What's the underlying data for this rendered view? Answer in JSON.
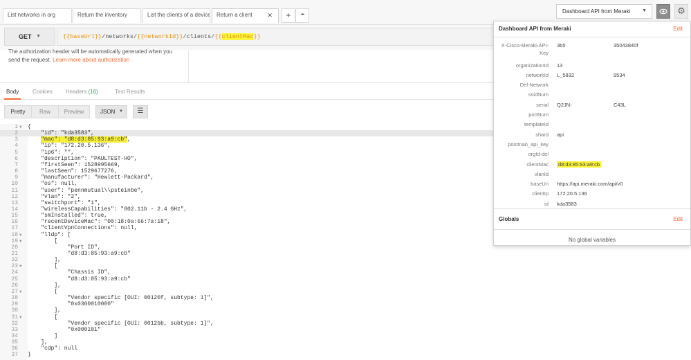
{
  "tabs": [
    {
      "label": "List networks in org"
    },
    {
      "label": "Return the inventory"
    },
    {
      "label": "List the clients of a device,"
    },
    {
      "label": "Return a client",
      "close": "✕"
    }
  ],
  "tab_actions": {
    "add": "+",
    "more": "•••"
  },
  "environment": {
    "selected": "Dashboard API from Meraki"
  },
  "request": {
    "method": "GET",
    "url_parts": [
      "{{baseUrl}}",
      "/networks/",
      "{{networkId}}",
      "/clients/",
      "{{",
      "clientMac",
      "}}"
    ]
  },
  "auth": {
    "text": "The authorization header will be automatically generated when you send the request.",
    "link": "Learn more about authorization"
  },
  "response_tabs": [
    {
      "label": "Body"
    },
    {
      "label": "Cookies"
    },
    {
      "label": "Headers",
      "count": "(16)"
    },
    {
      "label": "Test Results"
    }
  ],
  "toolbar": {
    "pretty": "Pretty",
    "raw": "Raw",
    "preview": "Preview",
    "format": "JSON"
  },
  "code_lines": [
    "{",
    "    \"id\": \"kda3583\",",
    "    \"mac\": \"d8:d3:85:93:a9:cb\",",
    "    \"ip\": \"172.20.5.136\",",
    "    \"ip6\": \"\",",
    "    \"description\": \"PAULTEST-HO\",",
    "    \"firstSeen\": 1528995669,",
    "    \"lastSeen\": 1529677276,",
    "    \"manufacturer\": \"Hewlett-Packard\",",
    "    \"os\": null,",
    "    \"user\": \"pennmutual\\\\psteinbe\",",
    "    \"vlan\": \"2\",",
    "    \"switchport\": \"1\",",
    "    \"wirelessCapabilities\": \"802.11b - 2.4 GHz\",",
    "    \"smInstalled\": true,",
    "    \"recentDeviceMac\": \"00:18:0a:66:7a:18\",",
    "    \"clientVpnConnections\": null,",
    "    \"lldp\": [",
    "        [",
    "            \"Port ID\",",
    "            \"d8:d3:85:93:a9:cb\"",
    "        ],",
    "        [",
    "            \"Chassis ID\",",
    "            \"d8:d3:85:93:a9:cb\"",
    "        ],",
    "        [",
    "            \"Vendor specific [OUI: 00120f, subtype: 1]\",",
    "            \"0x0300010000\"",
    "        ],",
    "        [",
    "            \"Vendor specific [OUI: 0012bb, subtype: 1]\",",
    "            \"0x000101\"",
    "        ]",
    "    ],",
    "    \"cdp\": null",
    "}"
  ],
  "env_popover": {
    "title": "Dashboard API from Meraki",
    "edit": "Edit",
    "variables": [
      {
        "key": "X-Cisco-Meraki-API-",
        "key2": "Key",
        "value": "3b5",
        "value2": "35043840f"
      },
      {
        "key": "organizationId",
        "value": "13"
      },
      {
        "key": "networkId",
        "value": "L_5832",
        "value2": "9534"
      },
      {
        "key": "Del-Network",
        "value": ""
      },
      {
        "key": "ssidNum",
        "value": ""
      },
      {
        "key": "serial",
        "value": "Q2JN-",
        "value2": "C43L"
      },
      {
        "key": "portNum",
        "value": ""
      },
      {
        "key": "templateId",
        "value": ""
      },
      {
        "key": "shard",
        "value": "api"
      },
      {
        "key": "postman_api_key",
        "value": ""
      },
      {
        "key": "orgId-del",
        "value": ""
      },
      {
        "key": "clientMac",
        "value": "d8:d3:85:93:a9:cb"
      },
      {
        "key": "vlanId",
        "value": ""
      },
      {
        "key": "baseUri",
        "value": "https://api.meraki.com/api/v0"
      },
      {
        "key": "clientIp",
        "value": "172.20.5.136"
      },
      {
        "key": "id",
        "value": "kda3583"
      }
    ],
    "globals_title": "Globals",
    "globals_edit": "Edit",
    "no_globals": "No global variables"
  }
}
